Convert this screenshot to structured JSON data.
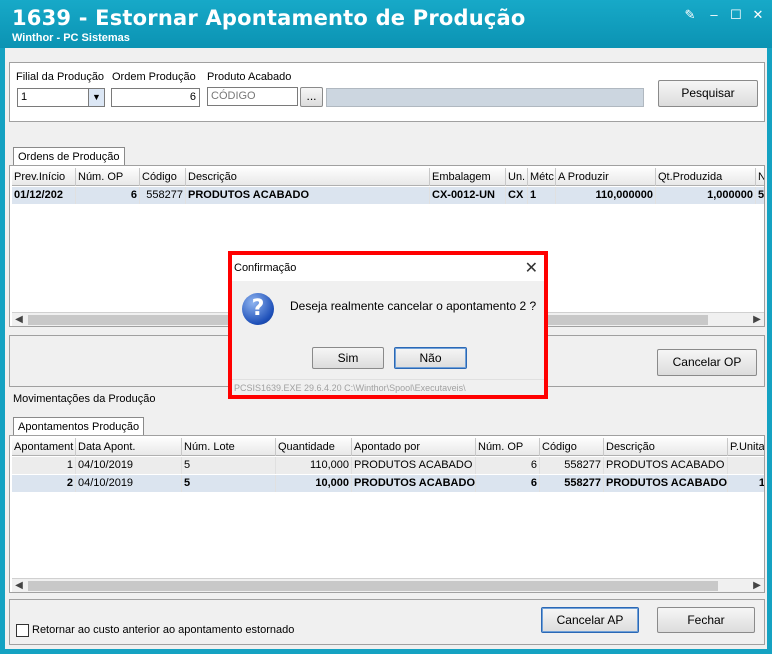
{
  "window": {
    "title": "1639 - Estornar Apontamento de Produção",
    "subtitle": "Winthor - PC Sistemas"
  },
  "filters": {
    "filial_label": "Filial da Produção",
    "filial_value": "1",
    "ordem_label": "Ordem Produção",
    "ordem_value": "6",
    "produto_label": "Produto Acabado",
    "produto_placeholder": "CÓDIGO",
    "browse_label": "...",
    "pesquisar_label": "Pesquisar"
  },
  "ordens": {
    "tab_label": "Ordens de Produção",
    "columns": [
      "Prev.Início",
      "Núm. OP",
      "Código",
      "Descrição",
      "Embalagem",
      "Un.",
      "Métc",
      "A Produzir",
      "Qt.Produzida",
      "N"
    ],
    "rows": [
      [
        "01/12/202",
        "6",
        "558277",
        "PRODUTOS ACABADO",
        "CX-0012-UN",
        "CX",
        "1",
        "110,000000",
        "1,000000",
        "5"
      ]
    ],
    "cancelar_op_label": "Cancelar OP"
  },
  "movimentacoes": {
    "section_label": "Movimentações da Produção",
    "tab_label": "Apontamentos Produção",
    "columns": [
      "Apontament",
      "Data Apont.",
      "Núm. Lote",
      "Quantidade",
      "Apontado por",
      "Núm. OP",
      "Código",
      "Descrição",
      "P.Unita"
    ],
    "rows": [
      [
        "1",
        "04/10/2019",
        "5",
        "110,000",
        "PRODUTOS ACABADO",
        "6",
        "558277",
        "PRODUTOS ACABADO",
        ""
      ],
      [
        "2",
        "04/10/2019",
        "5",
        "10,000",
        "PRODUTOS ACABADO",
        "6",
        "558277",
        "PRODUTOS ACABADO",
        "1"
      ]
    ]
  },
  "footer": {
    "checkbox_label": "Retornar ao custo anterior ao apontamento estornado",
    "cancelar_ap_label": "Cancelar AP",
    "fechar_label": "Fechar"
  },
  "dialog": {
    "title": "Confirmação",
    "message": "Deseja realmente cancelar o apontamento 2 ?",
    "yes_label": "Sim",
    "no_label": "Não",
    "status": "PCSIS1639.EXE 29.6.4.20  C:\\Winthor\\Spool\\Executaveis\\"
  }
}
